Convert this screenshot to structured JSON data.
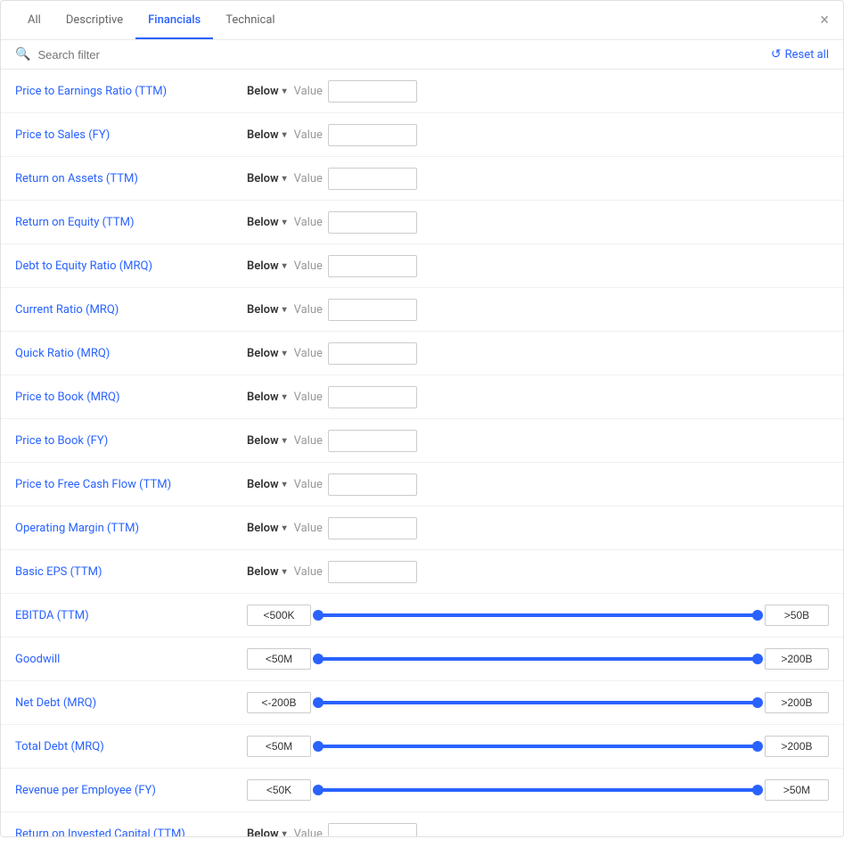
{
  "tabs": [
    {
      "id": "all",
      "label": "All",
      "active": false
    },
    {
      "id": "descriptive",
      "label": "Descriptive",
      "active": false
    },
    {
      "id": "financials",
      "label": "Financials",
      "active": true
    },
    {
      "id": "technical",
      "label": "Technical",
      "active": false
    }
  ],
  "search": {
    "placeholder": "Search filter"
  },
  "reset_label": "Reset all",
  "filters": [
    {
      "id": "pe-ratio",
      "label": "Price to Earnings Ratio",
      "suffix": "(TTM)",
      "type": "below",
      "dropdown": "Below",
      "value_label": "Value",
      "value": ""
    },
    {
      "id": "ps-ratio",
      "label": "Price to Sales",
      "suffix": "(FY)",
      "type": "below",
      "dropdown": "Below",
      "value_label": "Value",
      "value": ""
    },
    {
      "id": "roa",
      "label": "Return on Assets",
      "suffix": "(TTM)",
      "type": "below",
      "dropdown": "Below",
      "value_label": "Value",
      "value": ""
    },
    {
      "id": "roe",
      "label": "Return on Equity",
      "suffix": "(TTM)",
      "type": "below",
      "dropdown": "Below",
      "value_label": "Value",
      "value": ""
    },
    {
      "id": "debt-equity",
      "label": "Debt to Equity Ratio",
      "suffix": "(MRQ)",
      "type": "below",
      "dropdown": "Below",
      "value_label": "Value",
      "value": ""
    },
    {
      "id": "current-ratio",
      "label": "Current Ratio",
      "suffix": "(MRQ)",
      "type": "below",
      "dropdown": "Below",
      "value_label": "Value",
      "value": ""
    },
    {
      "id": "quick-ratio",
      "label": "Quick Ratio",
      "suffix": "(MRQ)",
      "type": "below",
      "dropdown": "Below",
      "value_label": "Value",
      "value": ""
    },
    {
      "id": "pb-mrq",
      "label": "Price to Book",
      "suffix": "(MRQ)",
      "type": "below",
      "dropdown": "Below",
      "value_label": "Value",
      "value": ""
    },
    {
      "id": "pb-fy",
      "label": "Price to Book",
      "suffix": "(FY)",
      "type": "below",
      "dropdown": "Below",
      "value_label": "Value",
      "value": ""
    },
    {
      "id": "pfcf",
      "label": "Price to Free Cash Flow",
      "suffix": "(TTM)",
      "type": "below",
      "dropdown": "Below",
      "value_label": "Value",
      "value": ""
    },
    {
      "id": "op-margin",
      "label": "Operating Margin",
      "suffix": "(TTM)",
      "type": "below",
      "dropdown": "Below",
      "value_label": "Value",
      "value": ""
    },
    {
      "id": "basic-eps",
      "label": "Basic EPS",
      "suffix": "(TTM)",
      "type": "below",
      "dropdown": "Below",
      "value_label": "Value",
      "value": ""
    },
    {
      "id": "ebitda",
      "label": "EBITDA",
      "suffix": "(TTM)",
      "type": "slider",
      "min": "<500K",
      "max": ">50B"
    },
    {
      "id": "goodwill",
      "label": "Goodwill",
      "suffix": "",
      "type": "slider",
      "min": "<50M",
      "max": ">200B"
    },
    {
      "id": "net-debt",
      "label": "Net Debt",
      "suffix": "(MRQ)",
      "type": "slider",
      "min": "<-200B",
      "max": ">200B"
    },
    {
      "id": "total-debt",
      "label": "Total Debt",
      "suffix": "(MRQ)",
      "type": "slider",
      "min": "<50M",
      "max": ">200B"
    },
    {
      "id": "rev-employee",
      "label": "Revenue per Employee",
      "suffix": "(FY)",
      "type": "slider",
      "min": "<50K",
      "max": ">50M"
    },
    {
      "id": "roic",
      "label": "Return on Invested Capital",
      "suffix": "(TTM)",
      "type": "below",
      "dropdown": "Below",
      "value_label": "Value",
      "value": ""
    }
  ],
  "colors": {
    "accent": "#2962ff",
    "text_blue": "#2962ff",
    "border": "#e0e0e0",
    "label_gray": "#999"
  }
}
